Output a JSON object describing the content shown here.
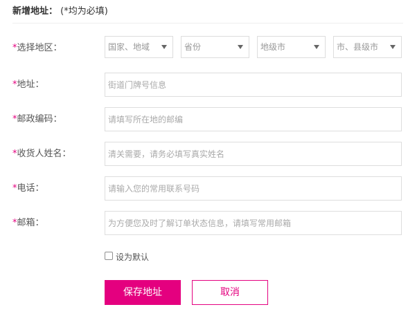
{
  "header": {
    "title": "新增地址：",
    "note": "(*均为必填)"
  },
  "colors": {
    "accent": "#e4007f",
    "label": "#555555",
    "placeholder": "#aaaaaa",
    "border": "#dddddd"
  },
  "required_mark": "*",
  "region": {
    "label": "选择地区：",
    "selects": [
      {
        "value": "国家、地域"
      },
      {
        "value": "省份"
      },
      {
        "value": "地级市"
      },
      {
        "value": "市、县级市"
      }
    ]
  },
  "fields": {
    "address": {
      "label": "地址：",
      "placeholder": "街道门牌号信息"
    },
    "postcode": {
      "label": "邮政编码：",
      "placeholder": "请填写所在地的邮编"
    },
    "recipient": {
      "label": "收货人姓名：",
      "placeholder": "清关需要，请务必填写真实姓名"
    },
    "phone": {
      "label": "电话：",
      "placeholder": "请输入您的常用联系号码"
    },
    "email": {
      "label": "邮箱：",
      "placeholder": "为方便您及时了解订单状态信息，请填写常用邮箱"
    }
  },
  "default_option": {
    "label": "设为默认",
    "checked": false
  },
  "buttons": {
    "save": "保存地址",
    "cancel": "取消"
  }
}
